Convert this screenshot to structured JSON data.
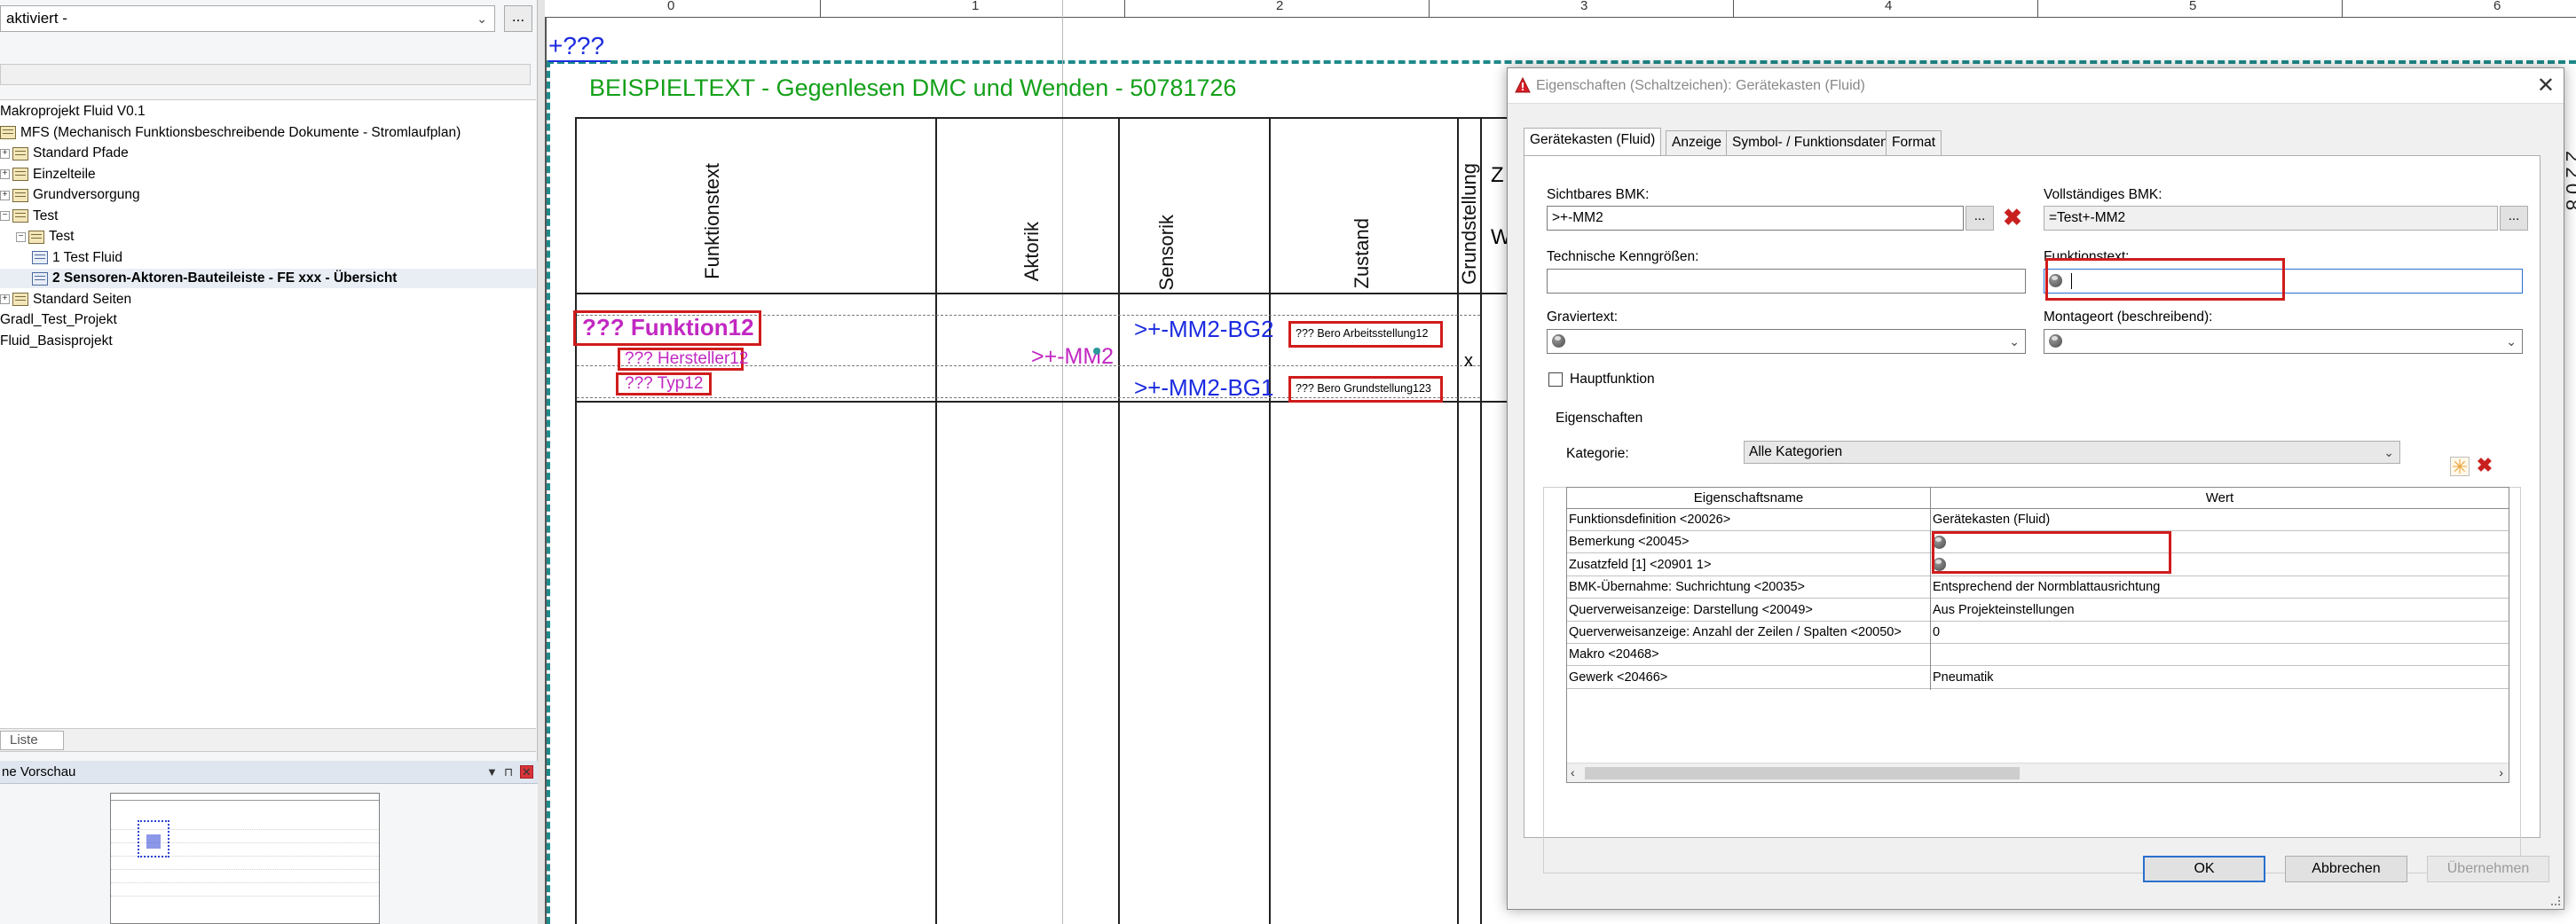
{
  "left": {
    "filter_value": "aktiviert -",
    "filter_btn": "...",
    "tree": [
      {
        "label": "Makroprojekt Fluid V0.1",
        "indent": 0,
        "exp": "",
        "icon": "none"
      },
      {
        "label": "MFS (Mechanisch Funktionsbeschreibende Dokumente - Stromlaufplan)",
        "indent": 0,
        "exp": "",
        "icon": "folder"
      },
      {
        "label": "Standard Pfade",
        "indent": 0,
        "exp": "+",
        "icon": "folder"
      },
      {
        "label": "Einzelteile",
        "indent": 0,
        "exp": "+",
        "icon": "folder"
      },
      {
        "label": "Grundversorgung",
        "indent": 0,
        "exp": "+",
        "icon": "folder"
      },
      {
        "label": "Test",
        "indent": 0,
        "exp": "-",
        "icon": "folder"
      },
      {
        "label": "Test",
        "indent": 1,
        "exp": "-",
        "icon": "folder"
      },
      {
        "label": "1 Test Fluid",
        "indent": 2,
        "exp": "",
        "icon": "page"
      },
      {
        "label": "2 Sensoren-Aktoren-Bauteileiste - FE xxx - Übersicht",
        "indent": 2,
        "exp": "",
        "icon": "page",
        "selected": true
      },
      {
        "label": "Standard Seiten",
        "indent": 0,
        "exp": "+",
        "icon": "folder"
      },
      {
        "label": "Gradl_Test_Projekt",
        "indent": -1,
        "exp": "",
        "icon": "none"
      },
      {
        "label": "Fluid_Basisprojekt",
        "indent": -1,
        "exp": "",
        "icon": "none"
      }
    ],
    "tab_liste": "Liste",
    "preview_title": "ne Vorschau",
    "preview_pin": "▼ ⊓"
  },
  "ruler": {
    "labels": [
      "0",
      "1",
      "2",
      "3",
      "4",
      "5",
      "6"
    ]
  },
  "drawing": {
    "plus_marker": "+???",
    "title": "BEISPIELTEXT - Gegenlesen DMC und Wenden - 50781726",
    "col_headers": [
      "Funktionstext",
      "Aktorik",
      "Sensorik",
      "Zustand",
      "Grundstellung"
    ],
    "right_partial": [
      "Z",
      "W"
    ],
    "right_edge_text": "2 2 0 8",
    "funktion": "??? Funktion12",
    "hersteller": "??? Hersteller12",
    "typ": "??? Typ12",
    "aktorik_tag": ">+-MM2",
    "sensor1": ">+-MM2-BG2",
    "sensor2": ">+-MM2-BG1",
    "zustand1": "??? Bero Arbeitsstellung12",
    "zustand2": "??? Bero Grundstellung123",
    "x_mark": "x"
  },
  "dialog": {
    "title": "Eigenschaften (Schaltzeichen): Gerätekasten (Fluid)",
    "tabs": [
      "Gerätekasten (Fluid)",
      "Anzeige",
      "Symbol- / Funktionsdaten",
      "Format"
    ],
    "sichtbares_bmk_label": "Sichtbares BMK:",
    "sichtbares_bmk_value": ">+-MM2",
    "vollstaendiges_bmk_label": "Vollständiges BMK:",
    "vollstaendiges_bmk_value": "=Test+-MM2",
    "ellipsis": "...",
    "technische_label": "Technische Kenngrößen:",
    "funktionstext_label": "Funktionstext:",
    "graviertext_label": "Graviertext:",
    "montageort_label": "Montageort (beschreibend):",
    "hauptfunktion_label": "Hauptfunktion",
    "eigenschaften_group": "Eigenschaften",
    "kategorie_label": "Kategorie:",
    "kategorie_value": "Alle Kategorien",
    "col_name": "Eigenschaftsname",
    "col_wert": "Wert",
    "rows": [
      {
        "name": "Funktionsdefinition <20026>",
        "value": "Gerätekasten (Fluid)",
        "globe": false
      },
      {
        "name": "Bemerkung <20045>",
        "value": "",
        "globe": true
      },
      {
        "name": "Zusatzfeld [1] <20901 1>",
        "value": "",
        "globe": true
      },
      {
        "name": "BMK-Übernahme: Suchrichtung <20035>",
        "value": "Entsprechend der Normblattausrichtung",
        "globe": false
      },
      {
        "name": "Querverweisanzeige: Darstellung <20049>",
        "value": "Aus Projekteinstellungen",
        "globe": false
      },
      {
        "name": "Querverweisanzeige: Anzahl der Zeilen / Spalten <20050>",
        "value": "0",
        "globe": false
      },
      {
        "name": "Makro <20468>",
        "value": "",
        "globe": false
      },
      {
        "name": "Gewerk <20466>",
        "value": "Pneumatik",
        "globe": false
      }
    ],
    "ok": "OK",
    "cancel": "Abbrechen",
    "apply": "Übernehmen"
  }
}
